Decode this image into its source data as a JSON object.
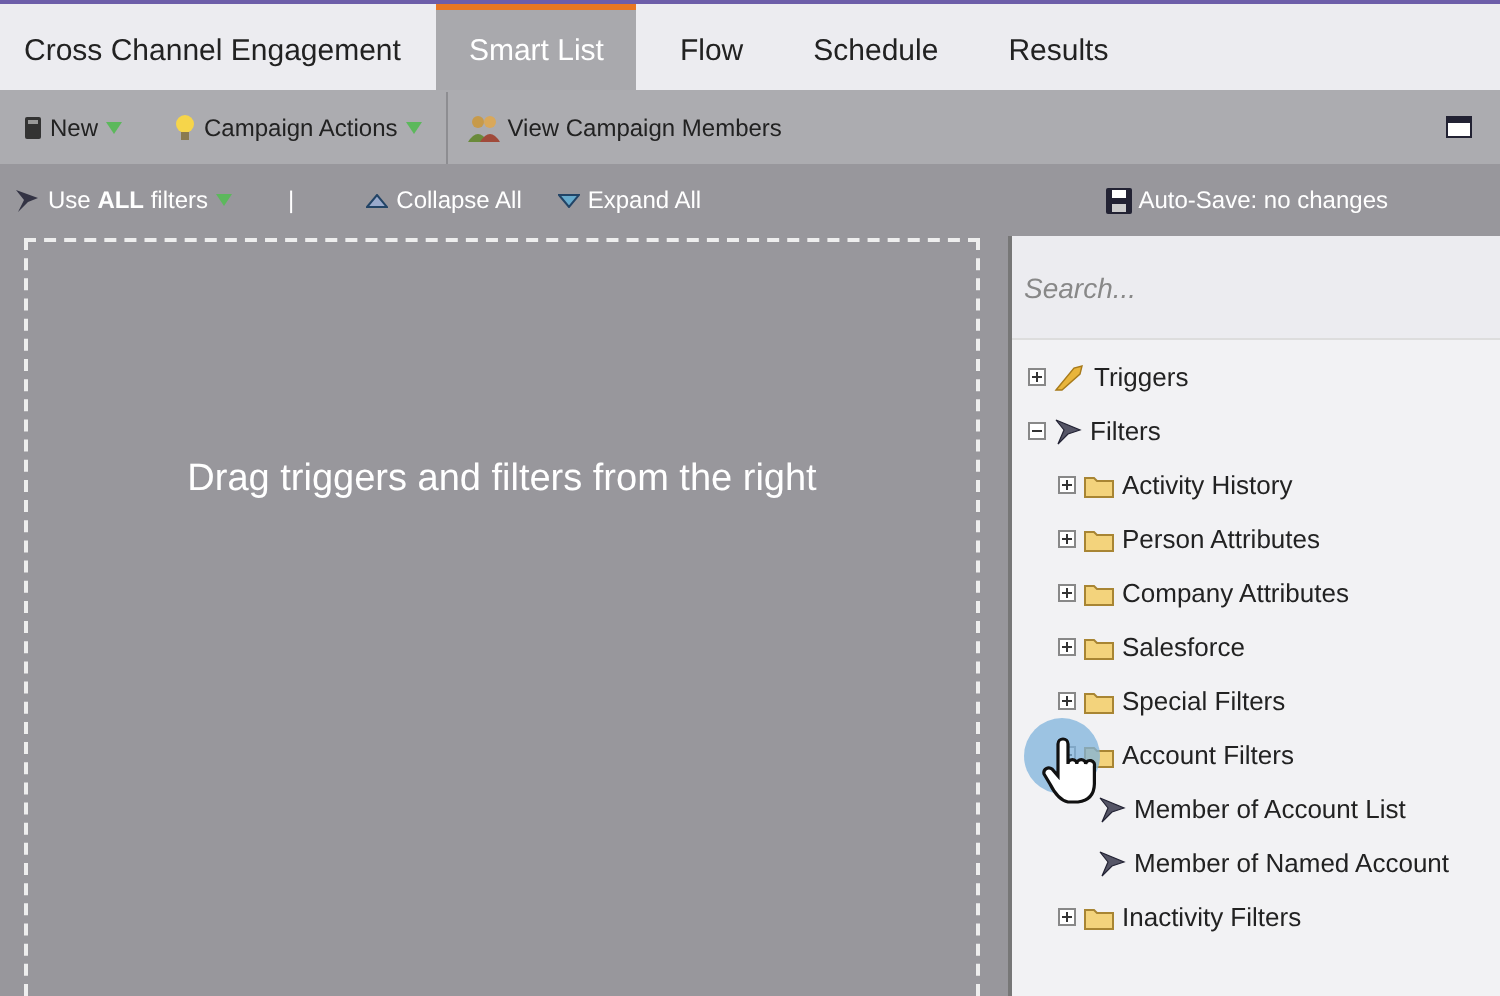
{
  "tabs": [
    {
      "label": "Cross Channel Engagement",
      "selected": false
    },
    {
      "label": "Smart List",
      "selected": true
    },
    {
      "label": "Flow",
      "selected": false
    },
    {
      "label": "Schedule",
      "selected": false
    },
    {
      "label": "Results",
      "selected": false
    }
  ],
  "toolbar": [
    {
      "label": "New",
      "kind": "new",
      "dropdown": true
    },
    {
      "label": "Campaign Actions",
      "kind": "bulb",
      "dropdown": true
    },
    {
      "label": "View Campaign Members",
      "kind": "members",
      "dropdown": false
    }
  ],
  "filter_bar": {
    "logic": "Use **ALL** filters",
    "separator": "|",
    "collapse": "Collapse All",
    "expand": "Expand All",
    "autosave": "Auto-Save: no changes"
  },
  "canvas": {
    "hint": "Drag triggers and filters from the right"
  },
  "library": {
    "search": {
      "placeholder": "Search..."
    },
    "tree": [
      {
        "label": "Triggers",
        "kind": "triggers",
        "expanded": false
      },
      {
        "label": "Filters",
        "kind": "filters",
        "expanded": true,
        "children": [
          {
            "label": "Activity History",
            "kind": "folder",
            "expanded": false
          },
          {
            "label": "Person Attributes",
            "kind": "folder",
            "expanded": false
          },
          {
            "label": "Company Attributes",
            "kind": "folder",
            "expanded": false
          },
          {
            "label": "Salesforce",
            "kind": "folder",
            "expanded": false
          },
          {
            "label": "Special Filters",
            "kind": "folder",
            "expanded": false
          },
          {
            "label": "Account Filters",
            "kind": "folder",
            "expanded": true,
            "children": [
              {
                "label": "Member of Account List",
                "kind": "filter"
              },
              {
                "label": "Member of Named Account",
                "kind": "filter"
              }
            ]
          },
          {
            "label": "Inactivity Filters",
            "kind": "folder",
            "expanded": false
          }
        ]
      }
    ]
  }
}
